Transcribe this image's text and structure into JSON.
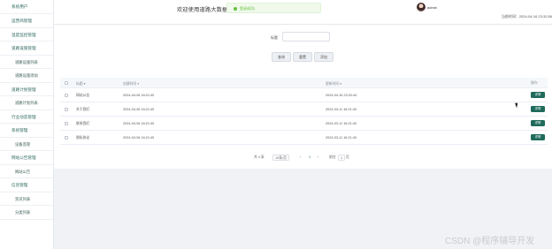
{
  "sidebar": {
    "items": [
      {
        "label": "系统用户"
      },
      {
        "label": "运营商管理"
      },
      {
        "label": "温度监控管理"
      },
      {
        "label": "道路设施管理"
      },
      {
        "label": "道路设施列表"
      },
      {
        "label": "道路设施添加"
      },
      {
        "label": "道路计划管理"
      },
      {
        "label": "道路计划列表"
      },
      {
        "label": "行业动态管理"
      },
      {
        "label": "系统管理"
      },
      {
        "label": "设备监管"
      },
      {
        "label": "网站公告管理"
      },
      {
        "label": "网站公告"
      },
      {
        "label": "信息管理"
      },
      {
        "label": "资讯列表"
      },
      {
        "label": "分类列表"
      }
    ]
  },
  "header": {
    "welcome": "欢迎使用道路大数据监控",
    "toast": "登录成功!",
    "username": "admin",
    "current_time": "当前时间：2024-04-16 23:32:56"
  },
  "search": {
    "label": "标题",
    "placeholder": "",
    "query_btn": "查询",
    "reset_btn": "重置",
    "add_btn": "添加"
  },
  "table": {
    "headers": {
      "title": "标题 ▾",
      "created": "创建时间 ▾",
      "updated": "更新时间 ▾",
      "action": "操作"
    },
    "rows": [
      {
        "title": "网站公告",
        "created": "2024-04-06 16:21:40",
        "updated": "2024-04-16 23:32:44",
        "action": "详情"
      },
      {
        "title": "关于我们",
        "created": "2024-04-06 16:21:40",
        "updated": "2024-03-11 16:21:40",
        "action": "详情"
      },
      {
        "title": "联系我们",
        "created": "2024-04-06 16:21:40",
        "updated": "2024-03-11 16:21:40",
        "action": "详情"
      },
      {
        "title": "隐私协议",
        "created": "2024-04-06 16:21:40",
        "updated": "2024-03-11 16:21:40",
        "action": "详情"
      }
    ]
  },
  "pager": {
    "total": "共 4 条",
    "page_size": "10条/页",
    "prev": "‹",
    "page": "1",
    "next": "›",
    "goto": "前往",
    "goto_value": "1",
    "page_suffix": "页"
  },
  "watermark": "CSDN @程序辅导开发",
  "colors": {
    "accent": "#1f6b5b",
    "sidebar_text": "#2f6b60",
    "toast_bg": "#f0f9eb",
    "toast_text": "#67c23a"
  }
}
